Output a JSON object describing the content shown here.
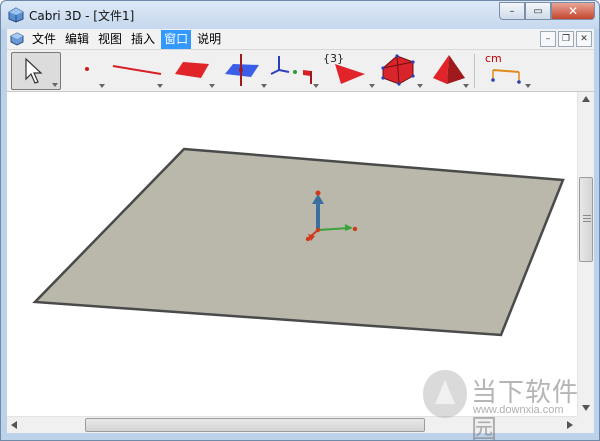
{
  "window": {
    "title": "Cabri 3D - [文件1]",
    "minimize_glyph": "–",
    "maximize_glyph": "▭",
    "close_glyph": "✕"
  },
  "menu": {
    "items": [
      "文件",
      "编辑",
      "视图",
      "插入",
      "窗口",
      "说明"
    ],
    "active_index": 4,
    "mdi_minimize": "–",
    "mdi_restore": "❐",
    "mdi_close": "✕"
  },
  "toolbar": {
    "tools": [
      {
        "name": "pointer-tool",
        "icon": "arrow-cursor-icon"
      },
      {
        "name": "point-tool",
        "icon": "point-icon"
      },
      {
        "name": "line-tool",
        "icon": "line-icon"
      },
      {
        "name": "plane-tool",
        "icon": "plane-icon"
      },
      {
        "name": "perpendicular-tool",
        "icon": "perpendicular-plane-icon"
      },
      {
        "name": "transform-tool",
        "icon": "axes-flag-icon"
      },
      {
        "name": "polygon-tool",
        "icon": "triangle-icon"
      },
      {
        "name": "polyhedron-tool",
        "icon": "polyhedron-icon"
      },
      {
        "name": "pyramid-tool",
        "icon": "pyramid-icon"
      },
      {
        "name": "measure-tool",
        "icon": "measure-icon"
      }
    ],
    "polygon_label": "{3}",
    "measure_label": "cm"
  },
  "colors": {
    "plane_fill": "#b9b8ab",
    "plane_edge": "#4a4a4a",
    "axis_z": "#3a6fa0",
    "axis_y": "#3aa23a",
    "axis_x": "#d03a1a",
    "active_menu": "#3399ff",
    "tool_red": "#d81f26"
  },
  "watermark": {
    "title": "当下软件园",
    "url": "www.downxia.com"
  }
}
